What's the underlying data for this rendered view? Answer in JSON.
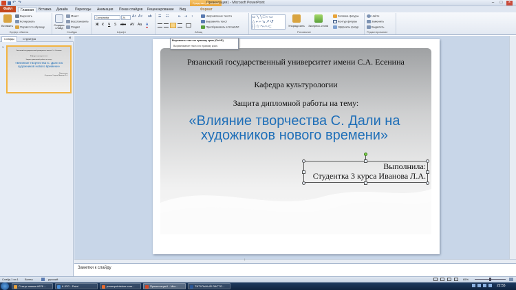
{
  "window": {
    "title": "Презентация1 - Microsoft PowerPoint",
    "context_group": "Средства рисования"
  },
  "tabs": [
    "Файл",
    "Главная",
    "Вставка",
    "Дизайн",
    "Переходы",
    "Анимация",
    "Показ слайдов",
    "Рецензирование",
    "Вид",
    "Формат"
  ],
  "ribbon": {
    "clipboard": {
      "label": "Буфер обмена",
      "paste": "Вставить",
      "cut": "Вырезать",
      "copy": "Копировать",
      "format_painter": "Формат по образцу"
    },
    "slides": {
      "label": "Слайды",
      "new_slide": "Создать слайд",
      "layout": "Макет",
      "reset": "Восстановить",
      "section": "Раздел"
    },
    "font": {
      "label": "Шрифт",
      "font_name": "Constantia",
      "font_size": "24"
    },
    "paragraph": {
      "label": "Абзац",
      "text_direction": "Направление текста",
      "align_text": "Выровнять текст",
      "smartart": "Преобразовать в SmartArt"
    },
    "drawing": {
      "label": "Рисование",
      "arrange": "Упорядочить",
      "quick_styles": "Экспресс-стили",
      "shape_fill": "Заливка фигуры",
      "shape_outline": "Контур фигуры",
      "shape_effects": "Эффекты фигур"
    },
    "editing": {
      "label": "Редактирование",
      "find": "Найти",
      "replace": "Заменить",
      "select": "Выделить"
    }
  },
  "tooltip": {
    "title": "Выровнять текст по правому краю (Ctrl+R)",
    "body": "Выравнивание текста по правому краю."
  },
  "left_panel": {
    "tab_slides": "Слайды",
    "tab_outline": "Структура",
    "slide_number": "1"
  },
  "slide": {
    "university": "Рязанский государственный университет имени С.А. Есенина",
    "department": "Кафедра культурологии",
    "defense": "Защита дипломной работы на тему:",
    "title": "«Влияние творчества С. Дали на художников нового времени»",
    "performed_by": "Выполнила:",
    "student": "Студентка 3 курса Иванова Л.А.",
    "colors": {
      "title": "#1f6fb8"
    }
  },
  "notes": {
    "placeholder": "Заметки к слайду"
  },
  "status": {
    "slide_counter": "Слайд 1 из 1",
    "theme": "Волна",
    "language": "русский",
    "zoom": "65%"
  },
  "taskbar": {
    "items": [
      {
        "label": "Статус заказа #976 ...",
        "color": "#e9a23b"
      },
      {
        "label": "6.JPG - Paint",
        "color": "#4a90d9"
      },
      {
        "label": "powerpointstore.com...",
        "color": "#e96b2e"
      },
      {
        "label": "Презентация1 - Micr...",
        "color": "#d24726"
      },
      {
        "label": "ТИТУЛЬНЫЙ ЛИСТ.D...",
        "color": "#2b5797"
      }
    ],
    "clock": "22:55"
  }
}
